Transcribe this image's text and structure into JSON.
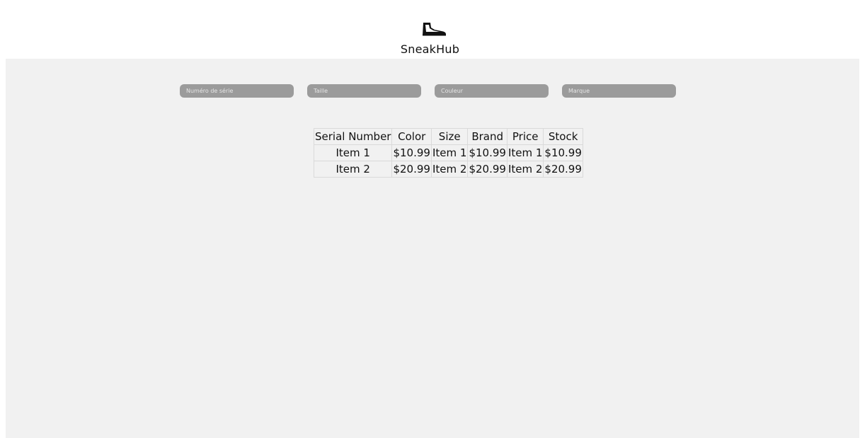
{
  "header": {
    "logo_icon": "sneaker-icon",
    "title": "SneakHub"
  },
  "filters": [
    {
      "placeholder": "Numéro de série"
    },
    {
      "placeholder": "Taille"
    },
    {
      "placeholder": "Couleur"
    },
    {
      "placeholder": "Marque"
    }
  ],
  "table": {
    "columns": [
      "Serial Number",
      "Color",
      "Size",
      "Brand",
      "Price",
      "Stock"
    ],
    "rows": [
      [
        "Item 1",
        "$10.99",
        "Item 1",
        "$10.99",
        "Item 1",
        "$10.99"
      ],
      [
        "Item 2",
        "$20.99",
        "Item 2",
        "$20.99",
        "Item 2",
        "$20.99"
      ]
    ]
  },
  "colors": {
    "panel_background": "#f1f1f1",
    "input_background": "#9b9b9b"
  }
}
